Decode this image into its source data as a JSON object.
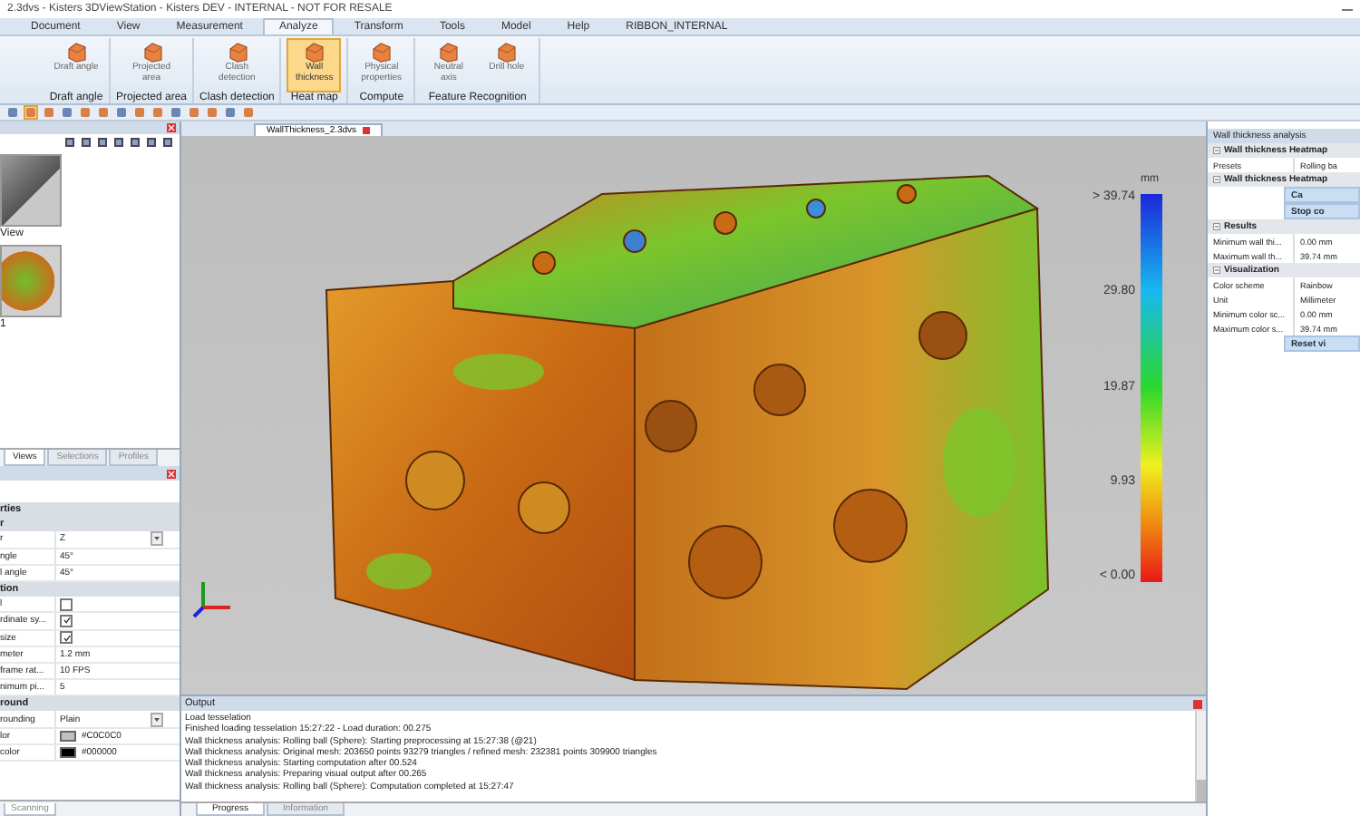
{
  "window": {
    "title": "2.3dvs - Kisters 3DViewStation - Kisters DEV - INTERNAL - NOT FOR RESALE"
  },
  "menu_tabs": [
    {
      "label": "Document",
      "selected": false
    },
    {
      "label": "View",
      "selected": false
    },
    {
      "label": "Measurement",
      "selected": false
    },
    {
      "label": "Analyze",
      "selected": true
    },
    {
      "label": "Transform",
      "selected": false
    },
    {
      "label": "Tools",
      "selected": false
    },
    {
      "label": "Model",
      "selected": false
    },
    {
      "label": "Help",
      "selected": false
    },
    {
      "label": "RIBBON_INTERNAL",
      "selected": false
    }
  ],
  "ribbon": {
    "groups": [
      {
        "label": "Draft angle",
        "buttons": [
          {
            "label": "Draft angle",
            "selected": false
          }
        ]
      },
      {
        "label": "Projected area",
        "buttons": [
          {
            "label": "Projected area",
            "selected": false
          }
        ]
      },
      {
        "label": "Clash detection",
        "buttons": [
          {
            "label": "Clash detection",
            "selected": false
          }
        ]
      },
      {
        "label": "Heat map",
        "buttons": [
          {
            "label": "Wall thickness",
            "selected": true
          }
        ]
      },
      {
        "label": "Compute",
        "buttons": [
          {
            "label": "Physical properties",
            "selected": false
          }
        ]
      },
      {
        "label": "Feature Recognition",
        "buttons": [
          {
            "label": "Neutral axis",
            "selected": false
          },
          {
            "label": "Drill hole",
            "selected": false
          }
        ]
      }
    ]
  },
  "toolbar": {
    "tools": [
      {
        "selected": false
      },
      {
        "selected": true
      },
      {
        "selected": false
      },
      {
        "selected": false
      },
      {
        "selected": false
      },
      {
        "selected": false
      },
      {
        "selected": false
      },
      {
        "selected": false
      },
      {
        "selected": false
      },
      {
        "selected": false
      },
      {
        "selected": false
      },
      {
        "selected": false
      },
      {
        "selected": false
      },
      {
        "selected": false
      }
    ]
  },
  "views_panel": {
    "thumbnails": [
      {
        "label": "View",
        "kind": "plain"
      },
      {
        "label": "1",
        "kind": "heatmap"
      }
    ],
    "tabs": [
      {
        "label": "Views",
        "selected": true
      },
      {
        "label": "Selections",
        "selected": false
      },
      {
        "label": "Profiles",
        "selected": false
      }
    ]
  },
  "properties": {
    "rows": [
      {
        "kind": "section",
        "label": "rties"
      },
      {
        "kind": "section",
        "label": "r"
      },
      {
        "kind": "dropdown",
        "label": "r",
        "value": "Z"
      },
      {
        "kind": "text",
        "label": "ngle",
        "value": "45°"
      },
      {
        "kind": "text",
        "label": "l angle",
        "value": "45°"
      },
      {
        "kind": "section",
        "label": "tion"
      },
      {
        "kind": "checkbox",
        "label": "l",
        "checked": false
      },
      {
        "kind": "checkbox",
        "label": "rdinate sy...",
        "checked": true
      },
      {
        "kind": "checkbox",
        "label": "size",
        "checked": true
      },
      {
        "kind": "text",
        "label": "meter",
        "value": "1.2 mm"
      },
      {
        "kind": "text",
        "label": "frame rat...",
        "value": "10 FPS"
      },
      {
        "kind": "text",
        "label": "nimum pi...",
        "value": "5"
      },
      {
        "kind": "section",
        "label": "round"
      },
      {
        "kind": "dropdown",
        "label": "rounding",
        "value": "Plain"
      },
      {
        "kind": "color",
        "label": "lor",
        "value": "#C0C0C0",
        "color": "#c0c0c0"
      },
      {
        "kind": "color",
        "label": "color",
        "value": "#000000",
        "color": "#000000"
      }
    ],
    "bottom_tab": "Scanning"
  },
  "document_tab": {
    "label": "WallThickness_2.3dvs"
  },
  "legend": {
    "unit": "mm",
    "ticks": [
      "> 39.74",
      "29.80",
      "19.87",
      "9.93",
      "< 0.00"
    ]
  },
  "output": {
    "title": "Output",
    "lines": [
      "Load tesselation",
      "Finished loading tesselation 15:27:22 - Load duration: 00.275",
      "Wall thickness analysis: Rolling ball (Sphere): Starting preprocessing at 15:27:38 (@21)",
      "Wall thickness analysis: Original mesh: 203650 points 93279 triangles / refined mesh: 232381 points 309900 triangles",
      "Wall thickness analysis: Starting computation after 00.524",
      "Wall thickness analysis: Preparing visual output after 00.265",
      "Wall thickness analysis: Rolling ball (Sphere): Computation completed at 15:27:47"
    ],
    "tabs": [
      {
        "label": "Progress",
        "selected": true
      },
      {
        "label": "Information",
        "selected": false
      }
    ]
  },
  "analysis_panel": {
    "title": "Wall thickness analysis",
    "rows": [
      {
        "kind": "section",
        "label": "Wall thickness Heatmap"
      },
      {
        "kind": "text",
        "label": "Presets",
        "value": "Rolling ba"
      },
      {
        "kind": "section",
        "label": "Wall thickness Heatmap"
      },
      {
        "kind": "button",
        "label": "Ca"
      },
      {
        "kind": "button",
        "label": "Stop co"
      },
      {
        "kind": "section",
        "label": "Results"
      },
      {
        "kind": "text",
        "label": "Minimum wall thi...",
        "value": "0.00 mm"
      },
      {
        "kind": "text",
        "label": "Maximum wall th...",
        "value": "39.74 mm"
      },
      {
        "kind": "section",
        "label": "Visualization"
      },
      {
        "kind": "text",
        "label": "Color scheme",
        "value": "Rainbow"
      },
      {
        "kind": "text",
        "label": "Unit",
        "value": "Millimeter"
      },
      {
        "kind": "text",
        "label": "Minimum color sc...",
        "value": "0.00 mm"
      },
      {
        "kind": "text",
        "label": "Maximum color s...",
        "value": "39.74 mm"
      },
      {
        "kind": "button",
        "label": "Reset vi"
      }
    ]
  }
}
